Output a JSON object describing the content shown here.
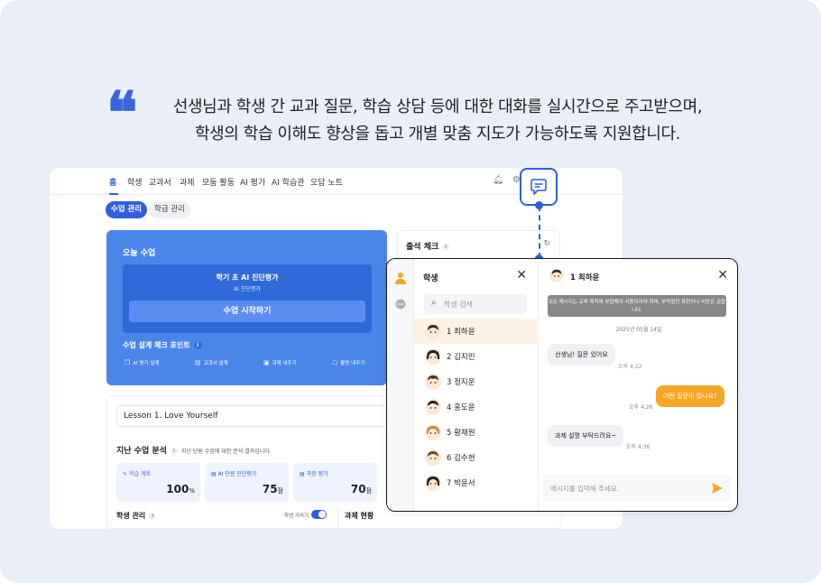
{
  "headline": {
    "line1": "선생님과 학생 간 교과 질문, 학습 상담 등에 대한 대화를 실시간으로 주고받으며,",
    "line2": "학생의 학습 이해도 향상을 돕고 개별 맞춤 지도가 가능하도록 지원합니다."
  },
  "nav": {
    "items": [
      "홈",
      "학생",
      "교과서",
      "과제",
      "모둠 활동",
      "AI 평가",
      "AI 학습관",
      "오답 노트"
    ],
    "active": "홈"
  },
  "subtabs": [
    "수업 관리",
    "학급 관리"
  ],
  "today": {
    "title": "오늘 수업",
    "box_title": "학기 초 AI 진단평가",
    "box_subtitle": "AI 진단평가",
    "start_button": "수업 시작하기",
    "points_title": "수업 설계 체크 포인트",
    "points": [
      "AI 평가 설계",
      "교과서 설계",
      "과제 내주기",
      "활동 내주기"
    ]
  },
  "attendance": {
    "title": "출석 체크"
  },
  "lesson": {
    "name": "Lesson 1. Love Yourself"
  },
  "analysis": {
    "title": "지난 수업 분석",
    "description": "지난 단원 수업에 대한 분석 결과입니다.",
    "cards": [
      {
        "label": "학습 계획",
        "value": "100",
        "unit": "%"
      },
      {
        "label": "AI 단원 진단평가",
        "value": "75",
        "unit": "점"
      },
      {
        "label": "과정 평가",
        "value": "70",
        "unit": "점"
      }
    ]
  },
  "student_mgmt": {
    "title": "학생 관리",
    "toggle_label": "학생 가리기"
  },
  "task_status": {
    "title": "과제 현황"
  },
  "chat": {
    "list_title": "학생",
    "search_placeholder": "학생 검색",
    "students": [
      "1 최하윤",
      "2 김지민",
      "3 정지운",
      "4 홍도윤",
      "5 황채원",
      "6 김수현",
      "7 박윤서"
    ],
    "active_student": "1 최하윤",
    "conversation_name": "1 최하윤",
    "notice": "모든 메시지는 교육 목적에 부합해야 사용되어야 하며, 부적절한 표현이나 비방은 금합니다.",
    "date": "2025년 05월 14일",
    "messages": [
      {
        "text": "선생님! 질문 있어요",
        "time": "오후 4:22",
        "from": "student"
      },
      {
        "text": "어떤 질문이 있나요?",
        "time": "오후 4:26",
        "from": "teacher"
      },
      {
        "text": "과제 설명 부탁드려요~",
        "time": "오후 4:36",
        "from": "student"
      }
    ],
    "input_placeholder": "메시지를 입력해 주세요."
  },
  "colors": {
    "accent": "#2f5fe0",
    "today_bg": "#4a86ea",
    "teacher_bubble": "#f5a623",
    "page_bg": "#e9eef8"
  }
}
